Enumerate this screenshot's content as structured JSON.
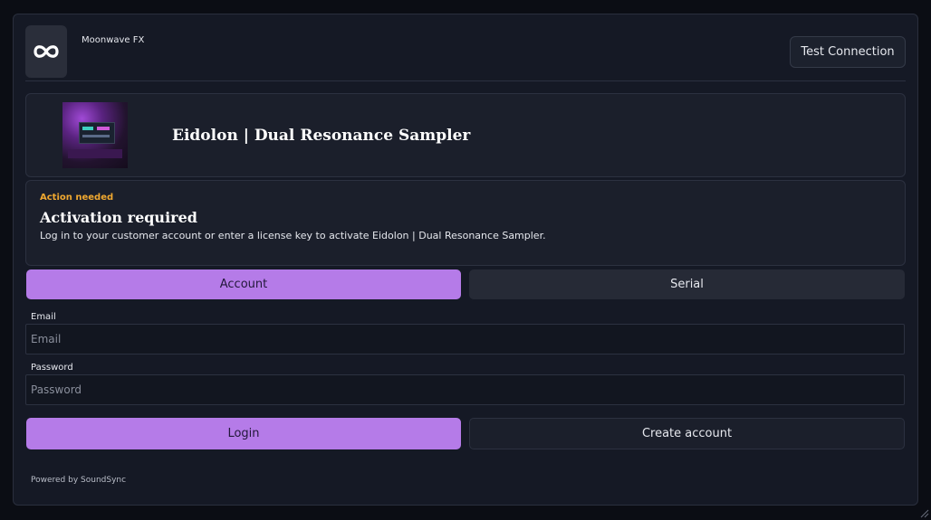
{
  "header": {
    "vendor": "Moonwave FX",
    "logo_icon": "infinity-icon",
    "test_connection_label": "Test Connection"
  },
  "product": {
    "title": "Eidolon | Dual Resonance Sampler",
    "art_icon": "product-artwork"
  },
  "notice": {
    "tag": "Action needed",
    "title": "Activation required",
    "message": "Log in to your customer account or enter a license key to activate Eidolon | Dual Resonance Sampler.",
    "tag_color": "#f0a830"
  },
  "tabs": [
    {
      "label": "Account",
      "active": true
    },
    {
      "label": "Serial",
      "active": false
    }
  ],
  "form": {
    "email_label": "Email",
    "email_placeholder": "Email",
    "email_value": "",
    "password_label": "Password",
    "password_placeholder": "Password",
    "password_value": ""
  },
  "actions": {
    "login_label": "Login",
    "create_account_label": "Create account"
  },
  "footer": {
    "powered_by": "Powered by SoundSync"
  },
  "colors": {
    "accent": "#b57be8",
    "background": "#151925",
    "panel": "#1b1f2b"
  }
}
